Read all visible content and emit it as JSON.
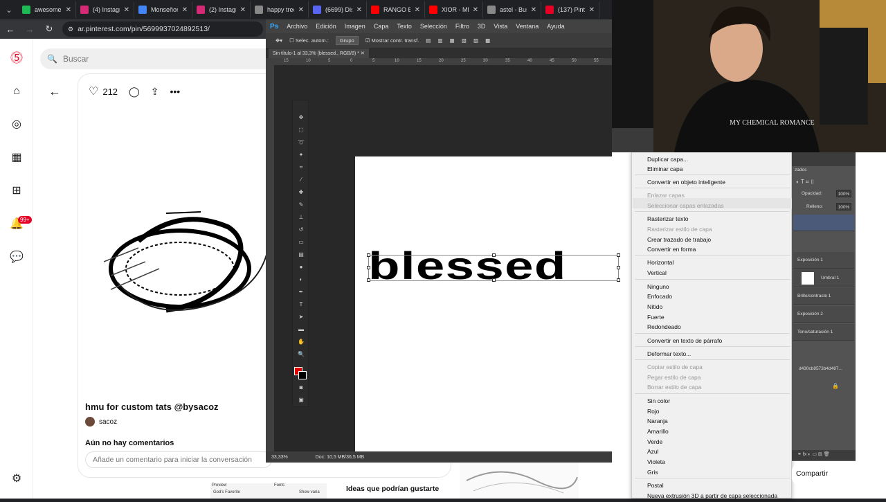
{
  "browser": {
    "tabs": [
      {
        "label": "awesome",
        "color": "#1db954"
      },
      {
        "label": "(4) Instagr",
        "color": "#d62976"
      },
      {
        "label": "Monseñor",
        "color": "#4285f4"
      },
      {
        "label": "(2) Instagr",
        "color": "#d62976"
      },
      {
        "label": "happy tree",
        "color": "#888888"
      },
      {
        "label": "(6699) Disc",
        "color": "#5865f2"
      },
      {
        "label": "RANGO B",
        "color": "#ff0000"
      },
      {
        "label": "XIOR - ME",
        "color": "#ff0000"
      },
      {
        "label": "astel - Bus",
        "color": "#888888"
      },
      {
        "label": "(137) Pinte",
        "color": "#e60023"
      }
    ],
    "url": "ar.pinterest.com/pin/5699937024892513/"
  },
  "pinterest": {
    "search_placeholder": "Buscar",
    "likes": "212",
    "notifications_badge": "99+",
    "pin_title": "hmu for custom tats @bysacoz",
    "author": "sacoz",
    "no_comments": "Aún no hay comentarios",
    "add_comment_placeholder": "Añade un comentario para iniciar la conversación",
    "ideas_heading": "Ideas que podrían gustarte",
    "share_label": "Compartir",
    "preview_labels": {
      "preview": "Preview",
      "fonts": "Fonts",
      "gods_favorite": "God's Favorite",
      "show_variants": "Show varia"
    }
  },
  "photoshop": {
    "logo": "Ps",
    "menu": [
      "Archivo",
      "Edición",
      "Imagen",
      "Capa",
      "Texto",
      "Selección",
      "Filtro",
      "3D",
      "Vista",
      "Ventana",
      "Ayuda"
    ],
    "options": {
      "auto_select": "Selec. autom.:",
      "group": "Grupo",
      "show_transform": "Mostrar contr. transf."
    },
    "doc_tab": "Sin título-1 al 33,3% (blessed., RGB/8) *",
    "ruler_ticks": [
      "15",
      "10",
      "5",
      "0",
      "5",
      "10",
      "15",
      "20",
      "25",
      "30",
      "35",
      "40",
      "45",
      "50",
      "55"
    ],
    "canvas_text": "blessed",
    "zoom": "33,33%",
    "doc_size": "Doc: 10,5 MB/36,5 MB",
    "fg_color": "#e00000",
    "bg_color": "#000000"
  },
  "context_menu": {
    "items": [
      {
        "label": "Duplicar capa...",
        "disabled": false
      },
      {
        "label": "Eliminar capa",
        "disabled": false
      },
      {
        "label": "Convertir en objeto inteligente",
        "disabled": false
      },
      {
        "label": "Enlazar capas",
        "disabled": true
      },
      {
        "label": "Seleccionar capas enlazadas",
        "disabled": true
      },
      {
        "label": "Rasterizar texto",
        "disabled": false
      },
      {
        "label": "Rasterizar estilo de capa",
        "disabled": true
      },
      {
        "label": "Crear trazado de trabajo",
        "disabled": false
      },
      {
        "label": "Convertir en forma",
        "disabled": false
      },
      {
        "label": "Horizontal",
        "disabled": false
      },
      {
        "label": "Vertical",
        "disabled": false
      },
      {
        "label": "Ninguno",
        "disabled": false
      },
      {
        "label": "Enfocado",
        "disabled": false
      },
      {
        "label": "Nítido",
        "disabled": false
      },
      {
        "label": "Fuerte",
        "disabled": false
      },
      {
        "label": "Redondeado",
        "disabled": false
      },
      {
        "label": "Convertir en texto de párrafo",
        "disabled": false
      },
      {
        "label": "Deformar texto...",
        "disabled": false
      },
      {
        "label": "Copiar estilo de capa",
        "disabled": true
      },
      {
        "label": "Pegar estilo de capa",
        "disabled": true
      },
      {
        "label": "Borrar estilo de capa",
        "disabled": true
      },
      {
        "label": "Sin color",
        "disabled": false
      },
      {
        "label": "Rojo",
        "disabled": false
      },
      {
        "label": "Naranja",
        "disabled": false
      },
      {
        "label": "Amarillo",
        "disabled": false
      },
      {
        "label": "Verde",
        "disabled": false
      },
      {
        "label": "Azul",
        "disabled": false
      },
      {
        "label": "Violeta",
        "disabled": false
      },
      {
        "label": "Gris",
        "disabled": false
      },
      {
        "label": "Postal",
        "disabled": false
      },
      {
        "label": "Nueva extrusión 3D a partir de capa seleccionada",
        "disabled": false
      }
    ]
  },
  "layers_panel": {
    "tab_label": "zados",
    "opacity_label": "Opacidad:",
    "opacity_value": "100%",
    "fill_label": "Relleno:",
    "fill_value": "100%",
    "layers": [
      "Exposición 1",
      "Umbral 1",
      "Brillo/contraste 1",
      "Exposición 2",
      "Tono/saturación 1"
    ],
    "hash": "d430cb8573b4d487..."
  },
  "webcam": {
    "shirt_text": "MY CHEMICAL ROMANCE"
  }
}
